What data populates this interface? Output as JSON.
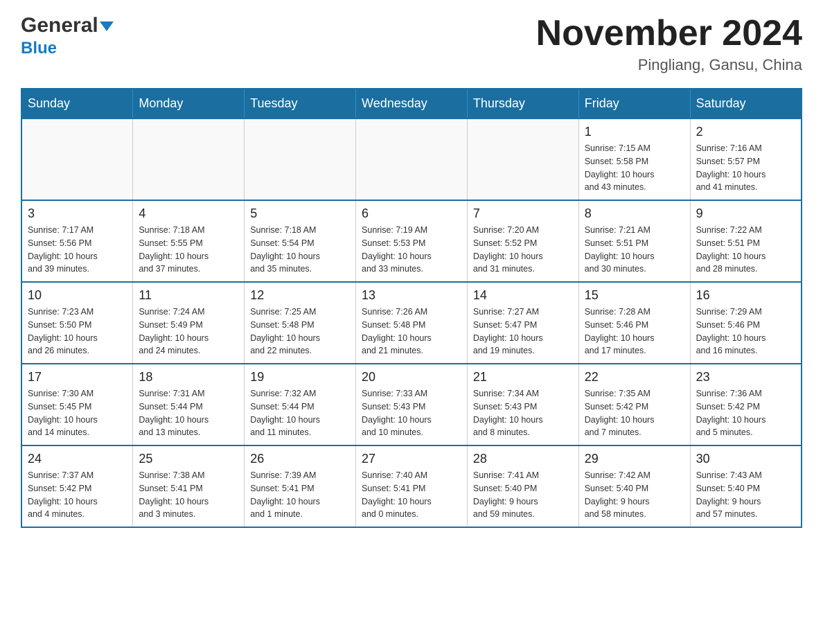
{
  "header": {
    "logo_general": "General",
    "logo_blue": "Blue",
    "main_title": "November 2024",
    "subtitle": "Pingliang, Gansu, China"
  },
  "days_of_week": [
    "Sunday",
    "Monday",
    "Tuesday",
    "Wednesday",
    "Thursday",
    "Friday",
    "Saturday"
  ],
  "weeks": [
    [
      {
        "day": "",
        "info": ""
      },
      {
        "day": "",
        "info": ""
      },
      {
        "day": "",
        "info": ""
      },
      {
        "day": "",
        "info": ""
      },
      {
        "day": "",
        "info": ""
      },
      {
        "day": "1",
        "info": "Sunrise: 7:15 AM\nSunset: 5:58 PM\nDaylight: 10 hours\nand 43 minutes."
      },
      {
        "day": "2",
        "info": "Sunrise: 7:16 AM\nSunset: 5:57 PM\nDaylight: 10 hours\nand 41 minutes."
      }
    ],
    [
      {
        "day": "3",
        "info": "Sunrise: 7:17 AM\nSunset: 5:56 PM\nDaylight: 10 hours\nand 39 minutes."
      },
      {
        "day": "4",
        "info": "Sunrise: 7:18 AM\nSunset: 5:55 PM\nDaylight: 10 hours\nand 37 minutes."
      },
      {
        "day": "5",
        "info": "Sunrise: 7:18 AM\nSunset: 5:54 PM\nDaylight: 10 hours\nand 35 minutes."
      },
      {
        "day": "6",
        "info": "Sunrise: 7:19 AM\nSunset: 5:53 PM\nDaylight: 10 hours\nand 33 minutes."
      },
      {
        "day": "7",
        "info": "Sunrise: 7:20 AM\nSunset: 5:52 PM\nDaylight: 10 hours\nand 31 minutes."
      },
      {
        "day": "8",
        "info": "Sunrise: 7:21 AM\nSunset: 5:51 PM\nDaylight: 10 hours\nand 30 minutes."
      },
      {
        "day": "9",
        "info": "Sunrise: 7:22 AM\nSunset: 5:51 PM\nDaylight: 10 hours\nand 28 minutes."
      }
    ],
    [
      {
        "day": "10",
        "info": "Sunrise: 7:23 AM\nSunset: 5:50 PM\nDaylight: 10 hours\nand 26 minutes."
      },
      {
        "day": "11",
        "info": "Sunrise: 7:24 AM\nSunset: 5:49 PM\nDaylight: 10 hours\nand 24 minutes."
      },
      {
        "day": "12",
        "info": "Sunrise: 7:25 AM\nSunset: 5:48 PM\nDaylight: 10 hours\nand 22 minutes."
      },
      {
        "day": "13",
        "info": "Sunrise: 7:26 AM\nSunset: 5:48 PM\nDaylight: 10 hours\nand 21 minutes."
      },
      {
        "day": "14",
        "info": "Sunrise: 7:27 AM\nSunset: 5:47 PM\nDaylight: 10 hours\nand 19 minutes."
      },
      {
        "day": "15",
        "info": "Sunrise: 7:28 AM\nSunset: 5:46 PM\nDaylight: 10 hours\nand 17 minutes."
      },
      {
        "day": "16",
        "info": "Sunrise: 7:29 AM\nSunset: 5:46 PM\nDaylight: 10 hours\nand 16 minutes."
      }
    ],
    [
      {
        "day": "17",
        "info": "Sunrise: 7:30 AM\nSunset: 5:45 PM\nDaylight: 10 hours\nand 14 minutes."
      },
      {
        "day": "18",
        "info": "Sunrise: 7:31 AM\nSunset: 5:44 PM\nDaylight: 10 hours\nand 13 minutes."
      },
      {
        "day": "19",
        "info": "Sunrise: 7:32 AM\nSunset: 5:44 PM\nDaylight: 10 hours\nand 11 minutes."
      },
      {
        "day": "20",
        "info": "Sunrise: 7:33 AM\nSunset: 5:43 PM\nDaylight: 10 hours\nand 10 minutes."
      },
      {
        "day": "21",
        "info": "Sunrise: 7:34 AM\nSunset: 5:43 PM\nDaylight: 10 hours\nand 8 minutes."
      },
      {
        "day": "22",
        "info": "Sunrise: 7:35 AM\nSunset: 5:42 PM\nDaylight: 10 hours\nand 7 minutes."
      },
      {
        "day": "23",
        "info": "Sunrise: 7:36 AM\nSunset: 5:42 PM\nDaylight: 10 hours\nand 5 minutes."
      }
    ],
    [
      {
        "day": "24",
        "info": "Sunrise: 7:37 AM\nSunset: 5:42 PM\nDaylight: 10 hours\nand 4 minutes."
      },
      {
        "day": "25",
        "info": "Sunrise: 7:38 AM\nSunset: 5:41 PM\nDaylight: 10 hours\nand 3 minutes."
      },
      {
        "day": "26",
        "info": "Sunrise: 7:39 AM\nSunset: 5:41 PM\nDaylight: 10 hours\nand 1 minute."
      },
      {
        "day": "27",
        "info": "Sunrise: 7:40 AM\nSunset: 5:41 PM\nDaylight: 10 hours\nand 0 minutes."
      },
      {
        "day": "28",
        "info": "Sunrise: 7:41 AM\nSunset: 5:40 PM\nDaylight: 9 hours\nand 59 minutes."
      },
      {
        "day": "29",
        "info": "Sunrise: 7:42 AM\nSunset: 5:40 PM\nDaylight: 9 hours\nand 58 minutes."
      },
      {
        "day": "30",
        "info": "Sunrise: 7:43 AM\nSunset: 5:40 PM\nDaylight: 9 hours\nand 57 minutes."
      }
    ]
  ]
}
